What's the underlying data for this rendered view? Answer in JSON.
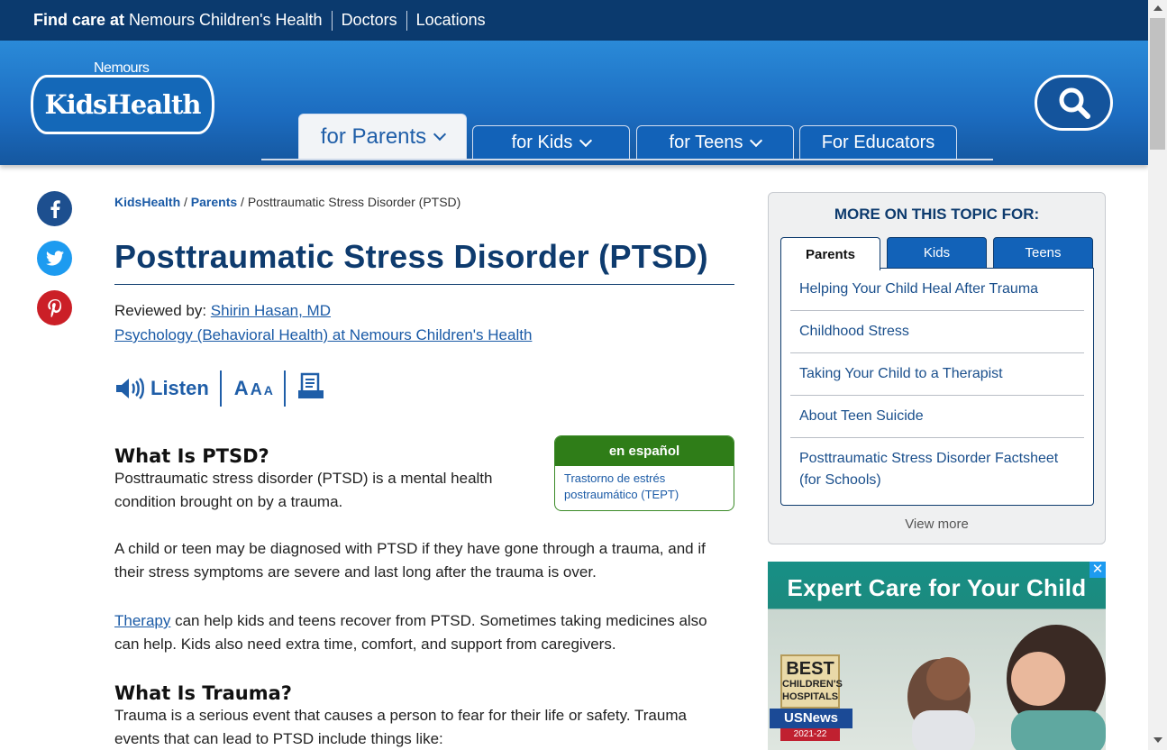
{
  "topbar": {
    "find_bold": "Find care at ",
    "find_rest": "Nemours Children's Health",
    "doctors": "Doctors",
    "locations": "Locations"
  },
  "logo": {
    "brand_small": "Nemours",
    "brand_main": "KidsHealth"
  },
  "nav": {
    "tabs": [
      {
        "label": "for Parents",
        "active": true
      },
      {
        "label": "for Kids"
      },
      {
        "label": "for Teens"
      },
      {
        "label": "For Educators"
      }
    ]
  },
  "breadcrumb": {
    "home": "KidsHealth",
    "sep1": " / ",
    "section": "Parents",
    "sep2": " / ",
    "current": "Posttraumatic Stress Disorder (PTSD)"
  },
  "article": {
    "title": "Posttraumatic Stress Disorder (PTSD)",
    "reviewed_label": "Reviewed by: ",
    "reviewer": "Shirin Hasan, MD",
    "department": "Psychology (Behavioral Health) at Nemours Children's Health",
    "listen": "Listen",
    "spanish": {
      "header": "en español",
      "link": "Trastorno de estrés postraumático (TEPT)"
    },
    "h_what": "What Is PTSD?",
    "p1": "Posttraumatic stress disorder (PTSD) is a mental health condition brought on by a trauma.",
    "p2": "A child or teen may be diagnosed with PTSD if they have gone through a trauma, and if their stress symptoms are severe and last long after the trauma is over.",
    "p3_link": "Therapy",
    "p3_rest": " can help kids and teens recover from PTSD. Sometimes taking medicines also can help. Kids also need extra time, comfort, and support from caregivers.",
    "h_trauma": "What Is Trauma?",
    "p4": "Trauma is a serious event that causes a person to fear for their life or safety. Trauma events that can lead to PTSD include things like:"
  },
  "sidebar": {
    "title": "MORE ON THIS TOPIC FOR:",
    "tabs": [
      "Parents",
      "Kids",
      "Teens"
    ],
    "links": [
      "Helping Your Child Heal After Trauma",
      "Childhood Stress",
      "Taking Your Child to a Therapist",
      "About Teen Suicide",
      "Posttraumatic Stress Disorder Factsheet (for Schools)"
    ],
    "view_more": "View more"
  },
  "ad": {
    "headline": "Expert Care for Your Child",
    "badge_line1": "BEST",
    "badge_line2": "CHILDREN'S",
    "badge_line3": "HOSPITALS",
    "badge_line4": "USNews",
    "badge_line5": "2021-22",
    "close": "✕"
  },
  "colors": {
    "navy": "#0b3a6e",
    "blue": "#1262b8",
    "link": "#1a5aa6",
    "green": "#2f7d18",
    "facebook": "#1d4f8f",
    "twitter": "#1d9bf0",
    "pinterest": "#cb1f27"
  },
  "icons": [
    "facebook-icon",
    "twitter-icon",
    "pinterest-icon",
    "search-icon",
    "speaker-icon",
    "text-size-icon",
    "print-icon",
    "chevron-down-icon",
    "close-icon"
  ]
}
